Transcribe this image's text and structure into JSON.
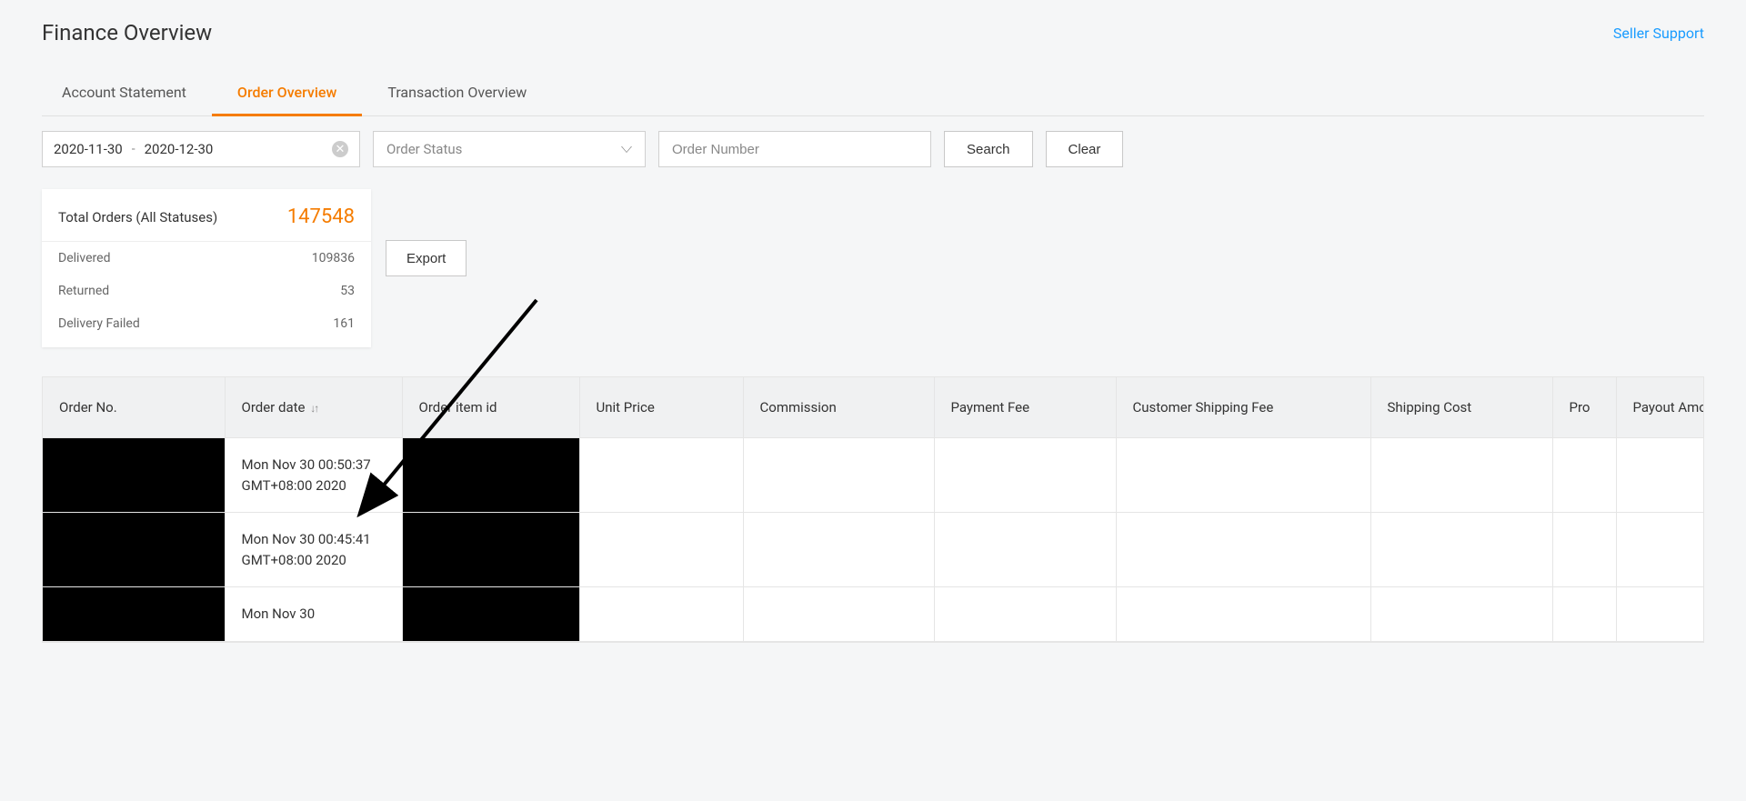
{
  "header": {
    "title": "Finance Overview",
    "support_link": "Seller Support"
  },
  "tabs": {
    "account_statement": "Account Statement",
    "order_overview": "Order Overview",
    "transaction_overview": "Transaction Overview"
  },
  "filters": {
    "date_from": "2020-11-30",
    "date_to": "2020-12-30",
    "order_status_placeholder": "Order Status",
    "order_number_placeholder": "Order Number",
    "search_label": "Search",
    "clear_label": "Clear"
  },
  "stats": {
    "total_label": "Total Orders (All Statuses)",
    "total_value": "147548",
    "lines": [
      {
        "label": "Delivered",
        "value": "109836"
      },
      {
        "label": "Returned",
        "value": "53"
      },
      {
        "label": "Delivery Failed",
        "value": "161"
      }
    ],
    "export_label": "Export"
  },
  "table": {
    "headers": {
      "order_no": "Order No.",
      "order_date": "Order date",
      "order_item_id": "Order item id",
      "unit_price": "Unit Price",
      "commission": "Commission",
      "payment_fee": "Payment Fee",
      "customer_shipping_fee": "Customer Shipping Fee",
      "shipping_cost": "Shipping Cost",
      "promo": "Pro",
      "payout_amount": "Payout Amount"
    },
    "rows": [
      {
        "order_date": "Mon Nov 30 00:50:37 GMT+08:00 2020"
      },
      {
        "order_date": "Mon Nov 30 00:45:41 GMT+08:00 2020"
      },
      {
        "order_date": "Mon Nov 30"
      }
    ]
  }
}
